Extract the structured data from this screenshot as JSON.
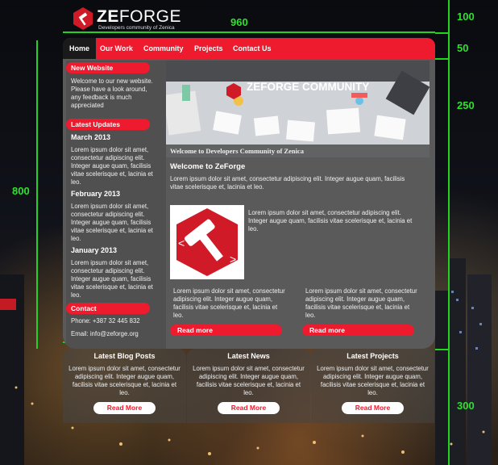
{
  "logo": {
    "brand_bold": "ZE",
    "brand_rest": "FORGE",
    "tagline": "Developers community of Zenica"
  },
  "guides": {
    "w960": "960",
    "h100": "100",
    "h50": "50",
    "h250": "250",
    "h800": "800",
    "w680": "680",
    "w256": "256",
    "h300": "300"
  },
  "nav": {
    "items": [
      "Home",
      "Our Work",
      "Community",
      "Projects",
      "Contact Us"
    ],
    "active_index": 0
  },
  "sidebar": {
    "new_website": {
      "title": "New Website",
      "text": "Welcome to our new website. Please have a look around, any feedback is much appreciated"
    },
    "updates": {
      "title": "Latest Updates",
      "entries": [
        {
          "month": "March 2013",
          "text": "Lorem ipsum dolor sit amet, consectetur adipiscing elit. Integer augue quam, facilisis vitae scelerisque et, lacinia et leo."
        },
        {
          "month": "February 2013",
          "text": "Lorem ipsum dolor sit amet, consectetur adipiscing elit. Integer augue quam, facilisis vitae scelerisque et, lacinia et leo."
        },
        {
          "month": "January 2013",
          "text": "Lorem ipsum dolor sit amet, consectetur adipiscing elit. Integer augue quam, facilisis vitae scelerisque et, lacinia et leo."
        }
      ]
    },
    "contact": {
      "title": "Contact",
      "phone": "Phone: +387 32 445 832",
      "email": "Email: info@zeforge.org"
    }
  },
  "banner": {
    "title": "ZEFORGE COMMUNITY",
    "caption": "Welcome to Developers Community of Zenica"
  },
  "main": {
    "welcome_title": "Welcome to ZeForge",
    "welcome_text": "Lorem ipsum dolor sit amet, consectetur adipiscing elit. Integer augue quam, facilisis vitae scelerisque et, lacinia et leo.",
    "image_text": "Lorem ipsum dolor sit amet, consectetur adipiscing elit. Integer augue quam, facilisis vitae scelerisque et, lacinia et leo.",
    "col1_text": "Lorem ipsum dolor sit amet, consectetur adipiscing elit. Integer augue quam, facilisis vitae scelerisque et, lacinia et leo.",
    "col2_text": "Lorem ipsum dolor sit amet, consectetur adipiscing elit. Integer augue quam, facilisis vitae scelerisque et, lacinia et leo.",
    "read_more": "Read more"
  },
  "bottom": {
    "boxes": [
      {
        "title": "Latest Blog Posts",
        "text": "Lorem ipsum dolor sit amet, consectetur adipiscing elit. Integer augue quam, facilisis vitae scelerisque et, lacinia et leo.",
        "button": "Read More"
      },
      {
        "title": "Latest News",
        "text": "Lorem ipsum dolor sit amet, consectetur adipiscing elit. Integer augue quam, facilisis vitae scelerisque et, lacinia et leo.",
        "button": "Read More"
      },
      {
        "title": "Latest Projects",
        "text": "Lorem ipsum dolor sit amet, consectetur adipiscing elit. Integer augue quam, facilisis vitae scelerisque et, lacinia et leo.",
        "button": "Read More"
      }
    ]
  },
  "colors": {
    "accent": "#ee1a2e",
    "panel": "#5a5a5a",
    "guide": "#22d322"
  }
}
